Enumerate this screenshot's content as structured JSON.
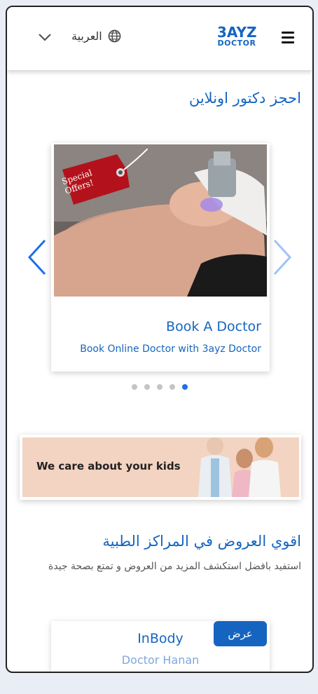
{
  "header": {
    "language": "العربية",
    "logo_line1": "3AYZ",
    "logo_line2": "DOCTOR"
  },
  "section1": {
    "title": "احجز دكتور اونلاين"
  },
  "carousel": {
    "badge": "Special Offers!",
    "card_title": "Book A Doctor",
    "card_subtitle": "Book Online Doctor with 3ayz Doctor",
    "dots_total": 5,
    "active_dot": 5
  },
  "banner": {
    "text": "We care about your kids"
  },
  "offers": {
    "title": "اقوي العروض في المراكز الطبية",
    "subtitle": "استفيد بافضل استكشف المزيد من العروض و تمتع بصحة جيدة",
    "card_title": "InBody",
    "card_doctor": "Doctor Hanan",
    "button_label": "عرض"
  },
  "colors": {
    "primary": "#1565c0",
    "dot_active": "#1e6fe8",
    "banner_bg": "#f3d3c2"
  }
}
